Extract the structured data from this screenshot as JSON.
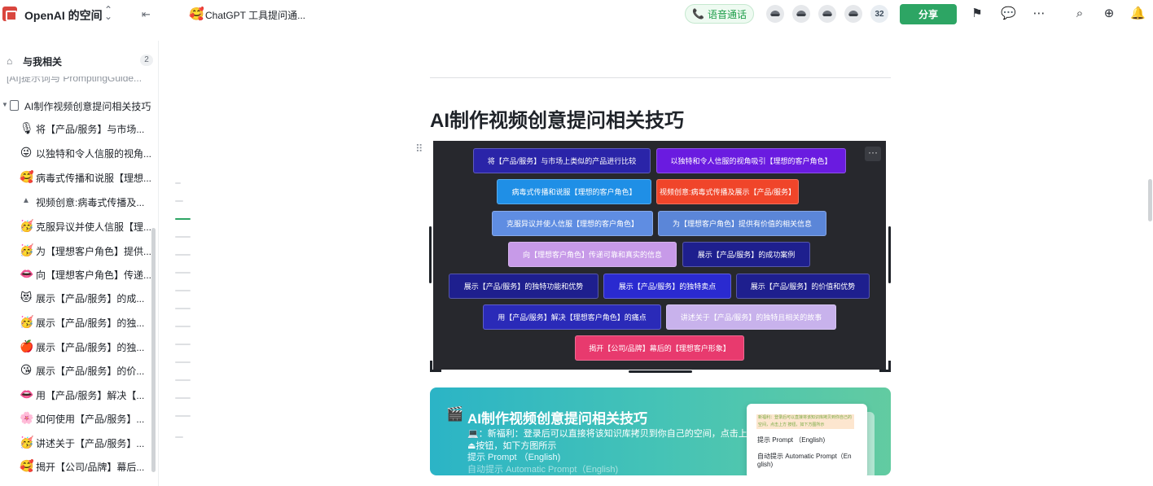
{
  "topbar": {
    "workspace_name": "OpenAI 的空间",
    "switch_glyph": "⌃⌄",
    "collapse_glyph": "⇤",
    "doc_emoji": "🥰",
    "doc_tab_title": "ChatGPT 工具提问通...",
    "voice_call_label": "语音通话",
    "collaborator_count": "32",
    "share_label": "分享",
    "icons": [
      "feedback-flag-icon",
      "chat-bubbles-icon",
      "more-icon",
      "search-icon",
      "add-icon",
      "bell-icon"
    ]
  },
  "sidebar": {
    "related_label": "与我相关",
    "related_count": "2",
    "cut_item_label": "[AI]提示词与 PromptingGuide...",
    "parent_label": "AI制作视频创意提问相关技巧",
    "items": [
      {
        "icon": "🎙",
        "label": "将【产品/服务】与市场..."
      },
      {
        "icon": "😜",
        "label": "以独特和令人信服的视角..."
      },
      {
        "icon": "🥰",
        "label": "病毒式传播和说服【理想..."
      },
      {
        "icon": "▲",
        "label": "视频创意:病毒式传播及..."
      },
      {
        "icon": "🥳",
        "label": "克服异议并使人信服【理..."
      },
      {
        "icon": "🥳",
        "label": "为【理想客户角色】提供..."
      },
      {
        "icon": "👄",
        "label": "向【理想客户角色】传递..."
      },
      {
        "icon": "😻",
        "label": "展示【产品/服务】的成..."
      },
      {
        "icon": "🥳",
        "label": "展示【产品/服务】的独..."
      },
      {
        "icon": "🍎",
        "label": "展示【产品/服务】的独..."
      },
      {
        "icon": "😘",
        "label": "展示【产品/服务】的价..."
      },
      {
        "icon": "👄",
        "label": "用【产品/服务】解决【..."
      },
      {
        "icon": "🌸",
        "label": "如何使用【产品/服务】..."
      },
      {
        "icon": "🥳",
        "label": "讲述关于【产品/服务】..."
      },
      {
        "icon": "🥰",
        "label": "揭开【公司/品牌】幕后..."
      }
    ]
  },
  "main": {
    "title": "AI制作视频创意提问相关技巧",
    "canvas_boxes": [
      {
        "label": "将【产品/服务】与市场上类似的产品进行比较",
        "color": "#2a24a8"
      },
      {
        "label": "以独特和令人信服的视角吸引【理想的客户角色】",
        "color": "#6a1be0"
      },
      {
        "label": "病毒式传播和说服【理想的客户角色】",
        "color": "#1f8fe6"
      },
      {
        "label": "视频创意:病毒式传播及展示【产品/服务】",
        "color": "#f0452a"
      },
      {
        "label": "克服异议并使人信服【理想的客户角色】",
        "color": "#5f8de2"
      },
      {
        "label": "为【理想客户角色】提供有价值的相关信息",
        "color": "#5b86d8"
      },
      {
        "label": "向【理想客户角色】传递可靠和真实的信息",
        "color": "#c79ae8"
      },
      {
        "label": "展示【产品/服务】的成功案例",
        "color": "#1e1f8e"
      },
      {
        "label": "展示【产品/服务】的独特功能和优势",
        "color": "#1e1f8e"
      },
      {
        "label": "展示【产品/服务】的独特卖点",
        "color": "#2a2ad0"
      },
      {
        "label": "展示【产品/服务】的价值和优势",
        "color": "#1e1f8e"
      },
      {
        "label": "用【产品/服务】解决【理想客户角色】的痛点",
        "color": "#2a2ab8"
      },
      {
        "label": "讲述关于【产品/服务】的独特且相关的故事",
        "color": "#c8b2ec"
      },
      {
        "label": "揭开【公司/品牌】幕后的【理想客户形象】",
        "color": "#e83a6e"
      }
    ],
    "card": {
      "emoji": "🎬",
      "title": "AI制作视频创意提问相关技巧",
      "line1": "💻：新福利：登录后可以直接将该知识库拷贝到你自己的空间，点击上方",
      "line2": "⏏按钮，如下方图所示",
      "line3": "提示 Prompt （English)",
      "line4": "自动提示 Automatic Prompt（English)",
      "shot_banner": "新福利：登录后可以直接将该知识库拷贝到你自己的空间，点击上方 按钮，如下方图所示",
      "shot_line1": "提示 Prompt （English)",
      "shot_line2": "自动提示 Automatic Prompt（En",
      "shot_line3": "glish)"
    }
  }
}
